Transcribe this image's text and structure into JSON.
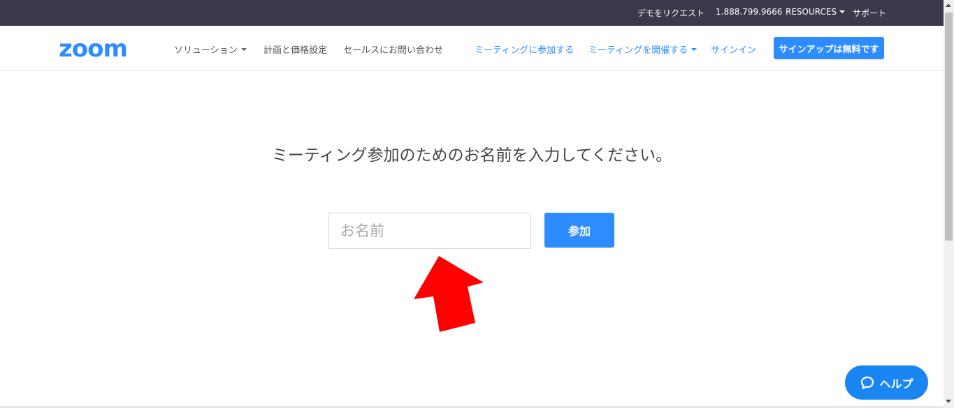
{
  "topbar": {
    "demo": "デモをリクエスト",
    "phone": "1.888.799.9666",
    "resources": "RESOURCES",
    "support": "サポート"
  },
  "nav": {
    "logo_text": "zoom",
    "solutions": "ソリューション",
    "pricing": "計画と価格設定",
    "contact_sales": "セールスにお問い合わせ",
    "join_meeting": "ミーティングに参加する",
    "host_meeting": "ミーティングを開催する",
    "sign_in": "サインイン",
    "sign_up": "サインアップは無料です"
  },
  "main": {
    "prompt": "ミーティング参加のためのお名前を入力してください。",
    "name_input": {
      "placeholder": "お名前",
      "value": ""
    },
    "join_button": "参加"
  },
  "help": {
    "label": "ヘルプ"
  },
  "colors": {
    "topbar_bg": "#3b3a4c",
    "accent": "#2d8cff",
    "help_bg": "#1a86f3",
    "arrow_annotation": "#ff0000"
  },
  "icons": [
    "caret-down-icon",
    "chat-bubble-icon",
    "red-arrow-annotation-icon"
  ]
}
